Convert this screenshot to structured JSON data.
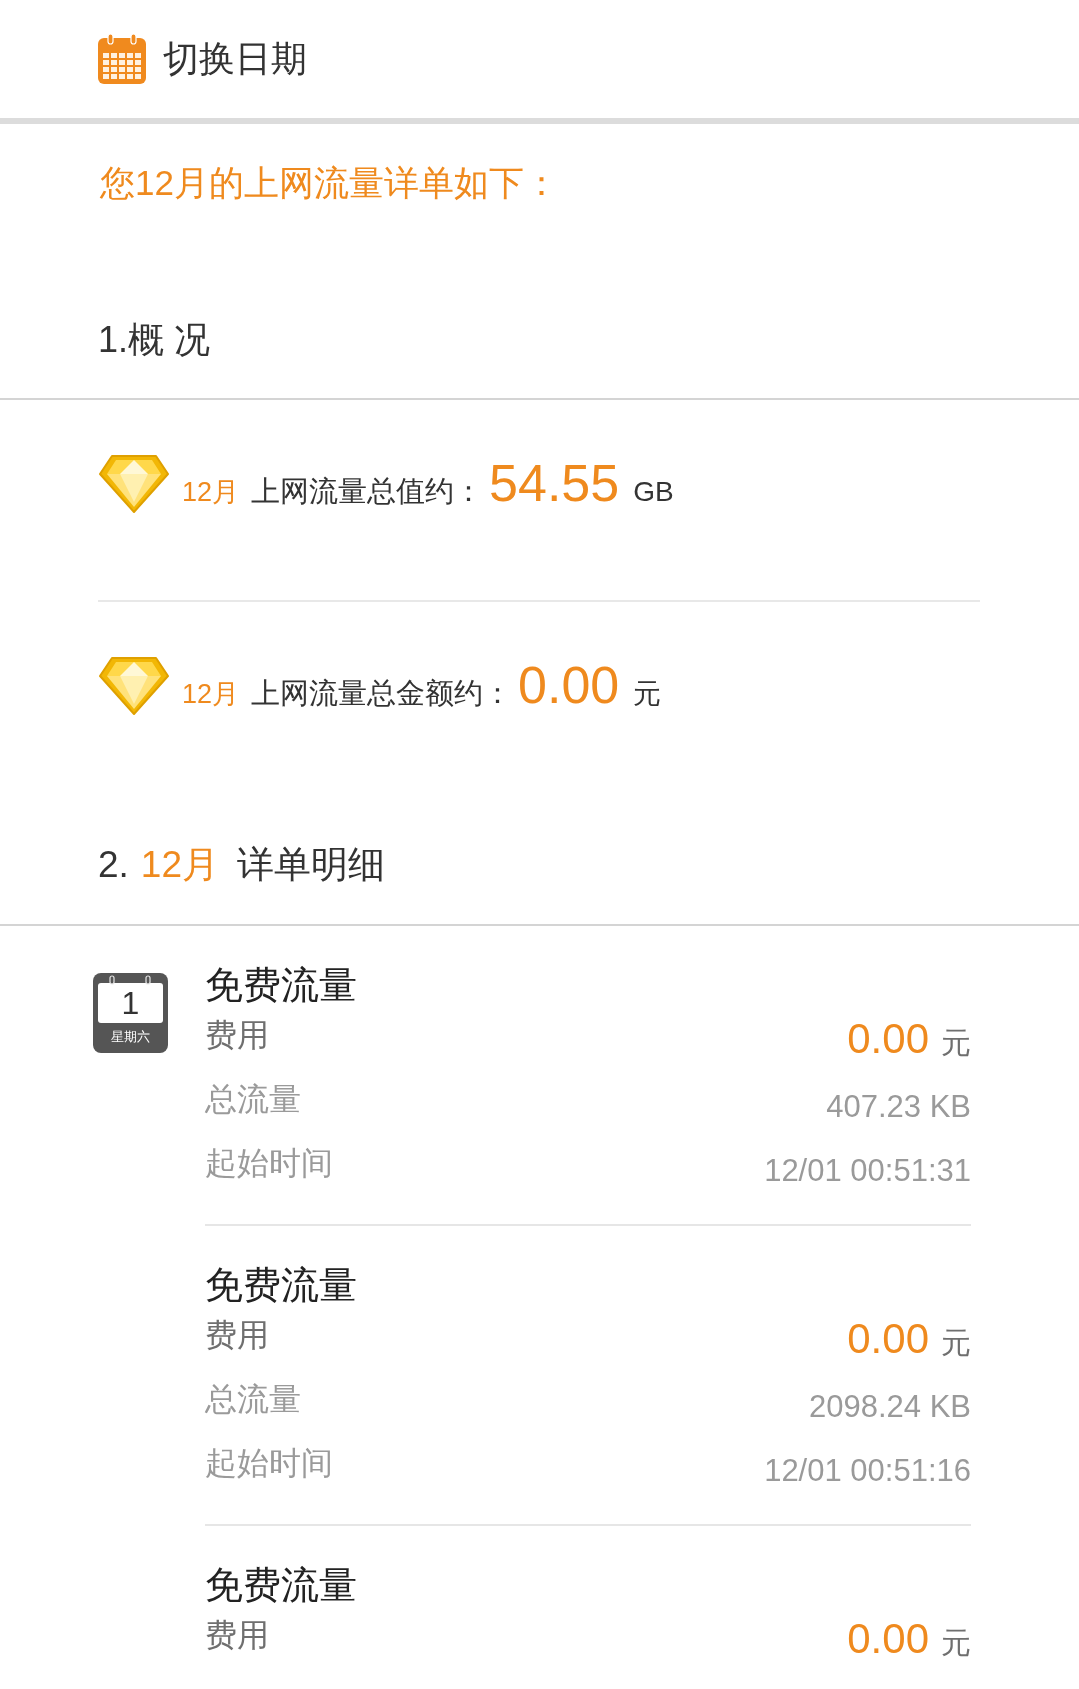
{
  "header": {
    "title": "切换日期"
  },
  "intro": "您12月的上网流量详单如下：",
  "overview": {
    "heading": "1.概 况",
    "items": [
      {
        "month": "12月",
        "label": "上网流量总值约：",
        "value": "54.55",
        "unit": "GB"
      },
      {
        "month": "12月",
        "label": "上网流量总金额约：",
        "value": "0.00",
        "unit": "元"
      }
    ]
  },
  "details": {
    "number": "2.",
    "month": "12月",
    "heading": "详单明细",
    "records": [
      {
        "day": {
          "date": "1",
          "weekday": "星期六"
        },
        "title": "免费流量",
        "fields": [
          {
            "kind": "fee",
            "label": "费用",
            "value": "0.00",
            "unit": "元"
          },
          {
            "kind": "plain",
            "label": "总流量",
            "value": "407.23 KB"
          },
          {
            "kind": "plain",
            "label": "起始时间",
            "value": "12/01 00:51:31"
          }
        ]
      },
      {
        "title": "免费流量",
        "fields": [
          {
            "kind": "fee",
            "label": "费用",
            "value": "0.00",
            "unit": "元"
          },
          {
            "kind": "plain",
            "label": "总流量",
            "value": "2098.24 KB"
          },
          {
            "kind": "plain",
            "label": "起始时间",
            "value": "12/01 00:51:16"
          }
        ]
      },
      {
        "title": "免费流量",
        "fields": [
          {
            "kind": "fee",
            "label": "费用",
            "value": "0.00",
            "unit": "元"
          }
        ]
      }
    ]
  }
}
